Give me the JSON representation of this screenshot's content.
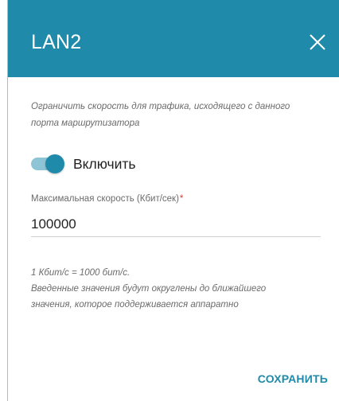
{
  "dialog": {
    "title": "LAN2",
    "close_icon": "close-icon",
    "description": "Ограничить скорость для трафика, исходящего с данного порта маршрутизатора",
    "toggle": {
      "label": "Включить",
      "state": "on"
    },
    "max_speed": {
      "label": "Максимальная скорость (Кбит/сек)",
      "required_mark": "*",
      "value": "100000"
    },
    "note_lines": [
      "1 Кбит/с = 1000 бит/с.",
      "Введенные значения будут округлены до ближайшего значения, которое поддерживается аппаратно"
    ],
    "save_label": "СОХРАНИТЬ"
  },
  "colors": {
    "header_bg": "#1f8aa9",
    "accent": "#1f8aa9",
    "toggle_track": "#8ec5d6",
    "required": "#e0392b"
  }
}
